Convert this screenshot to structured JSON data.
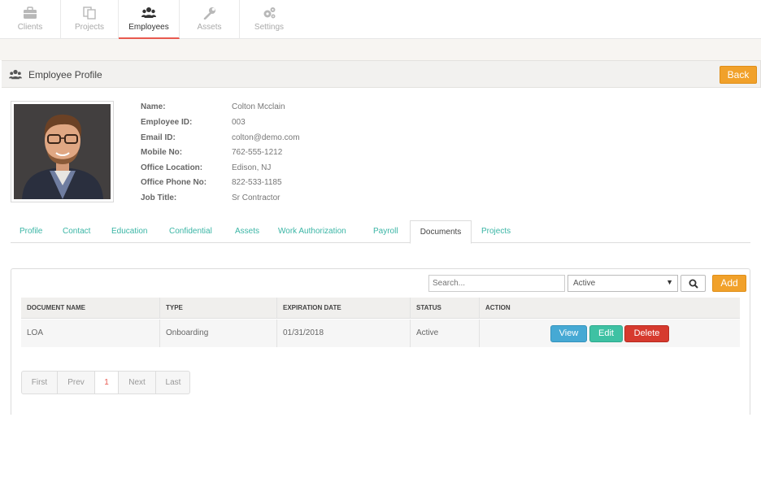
{
  "nav": {
    "items": [
      {
        "label": "Clients",
        "icon": "briefcase-icon"
      },
      {
        "label": "Projects",
        "icon": "copy-icon"
      },
      {
        "label": "Employees",
        "icon": "users-icon",
        "active": true
      },
      {
        "label": "Assets",
        "icon": "wrench-icon"
      },
      {
        "label": "Settings",
        "icon": "gears-icon"
      }
    ]
  },
  "header": {
    "title": "Employee Profile",
    "back_label": "Back"
  },
  "profile": {
    "fields": [
      {
        "label": "Name:",
        "value": "Colton Mcclain"
      },
      {
        "label": "Employee ID:",
        "value": "003"
      },
      {
        "label": "Email ID:",
        "value": "colton@demo.com"
      },
      {
        "label": "Mobile No:",
        "value": "762-555-1212"
      },
      {
        "label": "Office Location:",
        "value": "Edison, NJ"
      },
      {
        "label": "Office Phone No:",
        "value": "822-533-1185"
      },
      {
        "label": "Job Title:",
        "value": "Sr Contractor"
      }
    ]
  },
  "tabs": [
    "Profile",
    "Contact",
    "Education",
    "Confidential",
    "Assets",
    "Work Authorization",
    "Payroll",
    "Documents",
    "Projects"
  ],
  "active_tab": "Documents",
  "documents": {
    "search_placeholder": "Search...",
    "status_filter": "Active",
    "add_label": "Add",
    "columns": [
      "DOCUMENT NAME",
      "TYPE",
      "EXPIRATION DATE",
      "STATUS",
      "ACTION"
    ],
    "rows": [
      {
        "name": "LOA",
        "type": "Onboarding",
        "expiration": "01/31/2018",
        "status": "Active",
        "actions": {
          "view": "View",
          "edit": "Edit",
          "delete": "Delete"
        }
      }
    ]
  },
  "pagination": {
    "first": "First",
    "prev": "Prev",
    "current": "1",
    "next": "Next",
    "last": "Last"
  },
  "colors": {
    "accent_orange": "#f1a12a",
    "tab_teal": "#3ab5a5",
    "active_underline": "#e8594f",
    "view_blue": "#46a9d4",
    "edit_teal": "#3ec1a3",
    "delete_red": "#d63a2e"
  }
}
